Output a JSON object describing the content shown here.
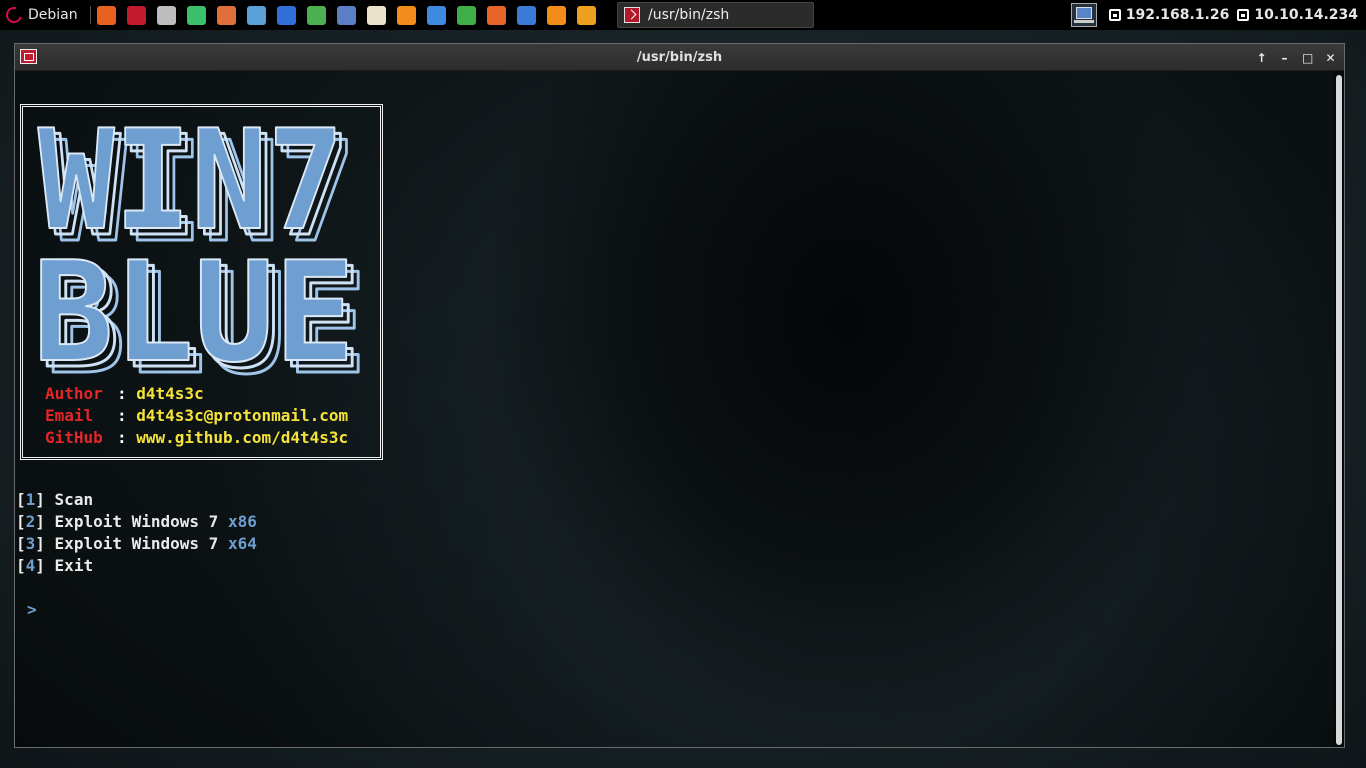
{
  "panel": {
    "menu_label": "Debian",
    "launchers": [
      {
        "icon": "firefox-icon",
        "color": "#e8621f"
      },
      {
        "icon": "terminal-icon",
        "color": "#c21b2f"
      },
      {
        "icon": "text-editor-icon",
        "color": "#bdbdbd"
      },
      {
        "icon": "network-tool-icon",
        "color": "#3bbf6a"
      },
      {
        "icon": "burpsuite-icon",
        "color": "#e0703a"
      },
      {
        "icon": "eye-icon",
        "color": "#5aa0d8"
      },
      {
        "icon": "shark-fin-icon",
        "color": "#2f6fd6"
      },
      {
        "icon": "snake-icon",
        "color": "#4caf50"
      },
      {
        "icon": "network-manager-icon",
        "color": "#5a7fc4"
      },
      {
        "icon": "notes-icon",
        "color": "#e9e4c9"
      },
      {
        "icon": "sublime-icon",
        "color": "#f28c1a"
      },
      {
        "icon": "document-icon",
        "color": "#3c8be0"
      },
      {
        "icon": "spreadsheet-icon",
        "color": "#3fae49"
      },
      {
        "icon": "presentation-icon",
        "color": "#e8652a"
      },
      {
        "icon": "globe-icon",
        "color": "#3a7bd5"
      },
      {
        "icon": "vlc-icon",
        "color": "#f28c1a"
      },
      {
        "icon": "search-icon",
        "color": "#f0a020"
      }
    ],
    "task_title": "/usr/bin/zsh",
    "ip_local": "192.168.1.26",
    "ip_vpn": "10.10.14.234"
  },
  "window": {
    "title": "/usr/bin/zsh"
  },
  "banner": {
    "logo_lines": [
      "WIN7",
      "BLUE"
    ],
    "logo_color": "#6f9fd0",
    "credits": [
      {
        "label": "Author",
        "value": "d4t4s3c"
      },
      {
        "label": "Email",
        "value": "d4t4s3c@protonmail.com"
      },
      {
        "label": "GitHub",
        "value": "www.github.com/d4t4s3c"
      }
    ]
  },
  "menu": {
    "items": [
      {
        "num": "1",
        "text": "Scan",
        "arch": ""
      },
      {
        "num": "2",
        "text": "Exploit Windows 7",
        "arch": "x86"
      },
      {
        "num": "3",
        "text": "Exploit Windows 7",
        "arch": "x64"
      },
      {
        "num": "4",
        "text": "Exit",
        "arch": ""
      }
    ],
    "prompt": ">"
  }
}
